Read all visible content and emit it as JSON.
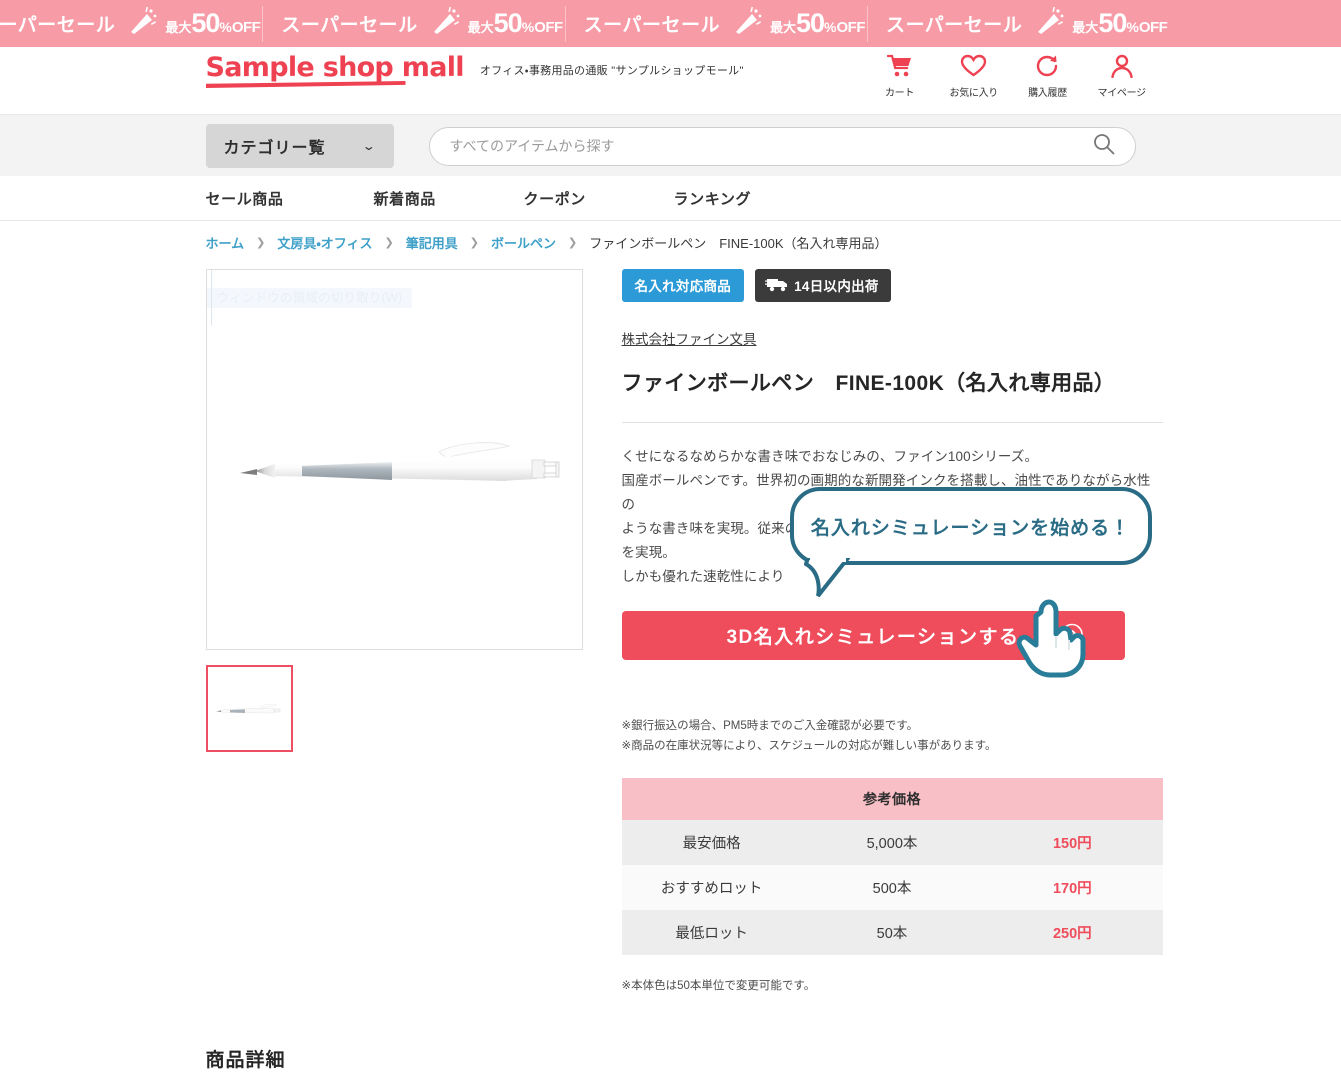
{
  "sale_banner": {
    "label": "スーパーセール",
    "max": "最大",
    "fifty": "50",
    "pct": "%",
    "off": "OFF",
    "bg_color": "#f79ba6",
    "repeat": 4
  },
  "header": {
    "logo": "Sample shop mall",
    "tagline": "オフィス・事務用品の通販 \"サンプルショップモール\"",
    "brand_color": "#ee4152",
    "icons": [
      {
        "name": "cart-icon",
        "label": "カート"
      },
      {
        "name": "heart-icon",
        "label": "お気に入り"
      },
      {
        "name": "history-icon",
        "label": "購入履歴"
      },
      {
        "name": "account-icon",
        "label": "マイページ"
      }
    ]
  },
  "search": {
    "category_label": "カテゴリー覧",
    "chevron": "⌄",
    "placeholder": "すべてのアイテムから探す",
    "value": ""
  },
  "nav": {
    "items": [
      {
        "label": "セール商品"
      },
      {
        "label": "新着商品"
      },
      {
        "label": "クーポン"
      },
      {
        "label": "ランキング"
      }
    ]
  },
  "breadcrumb": {
    "items": [
      {
        "label": "ホーム",
        "link": true
      },
      {
        "label": "文房具・オフィス",
        "link": true
      },
      {
        "label": "筆記用具",
        "link": true
      },
      {
        "label": "ボールペン",
        "link": true
      },
      {
        "label": "ファインボールペン　FINE-100K（名入れ専用品）",
        "link": false
      }
    ],
    "separator": "❯"
  },
  "gallery": {
    "ghost_tooltip": "ウィンドウの領域の切り取り(W)",
    "main_image_alt": "白いボールペン",
    "thumb_alt": "白いボールペン サムネイル",
    "thumb_selected_color": "#ee4f63"
  },
  "product": {
    "badge_naire": "名入れ対応商品",
    "badge_naire_color": "#2b9ad6",
    "badge_shipping": "14日以内出荷",
    "badge_shipping_color": "#3b3b3b",
    "vendor": "株式会社ファイン文具",
    "title": "ファインボールペン　FINE-100K（名入れ専用品）",
    "description_lines": [
      "くせになるなめらかな書き味でおなじみの、ファイン100シリーズ。",
      "国産ボールペンです。世界初の画期的な新開発インクを搭載し、油性でありながら水性の",
      "ような書き味を実現。従来の",
      "を実現。",
      "しかも優れた速乾性により"
    ],
    "cta_label": "3D名入れシミュレーションする",
    "cta_color": "#ef4d5c",
    "bubble_text": "名入れシミュレーションを始める！",
    "bubble_color": "#2a6c85",
    "notes": [
      "※銀行振込の場合、PM5時までのご入金確認が必要です。",
      "※商品の在庫状況等により、スケジュールの対応が難しい事があります。"
    ],
    "note_color": "※本体色は50本単位で変更可能です。"
  },
  "price_table": {
    "header": "参考価格",
    "header_bg": "#f9bfc6",
    "rows": [
      {
        "label": "最安価格",
        "qty": "5,000本",
        "price": "150円"
      },
      {
        "label": "おすすめロット",
        "qty": "500本",
        "price": "170円"
      },
      {
        "label": "最低ロット",
        "qty": "50本",
        "price": "250円"
      }
    ]
  },
  "detail_section": {
    "heading": "商品詳細"
  }
}
